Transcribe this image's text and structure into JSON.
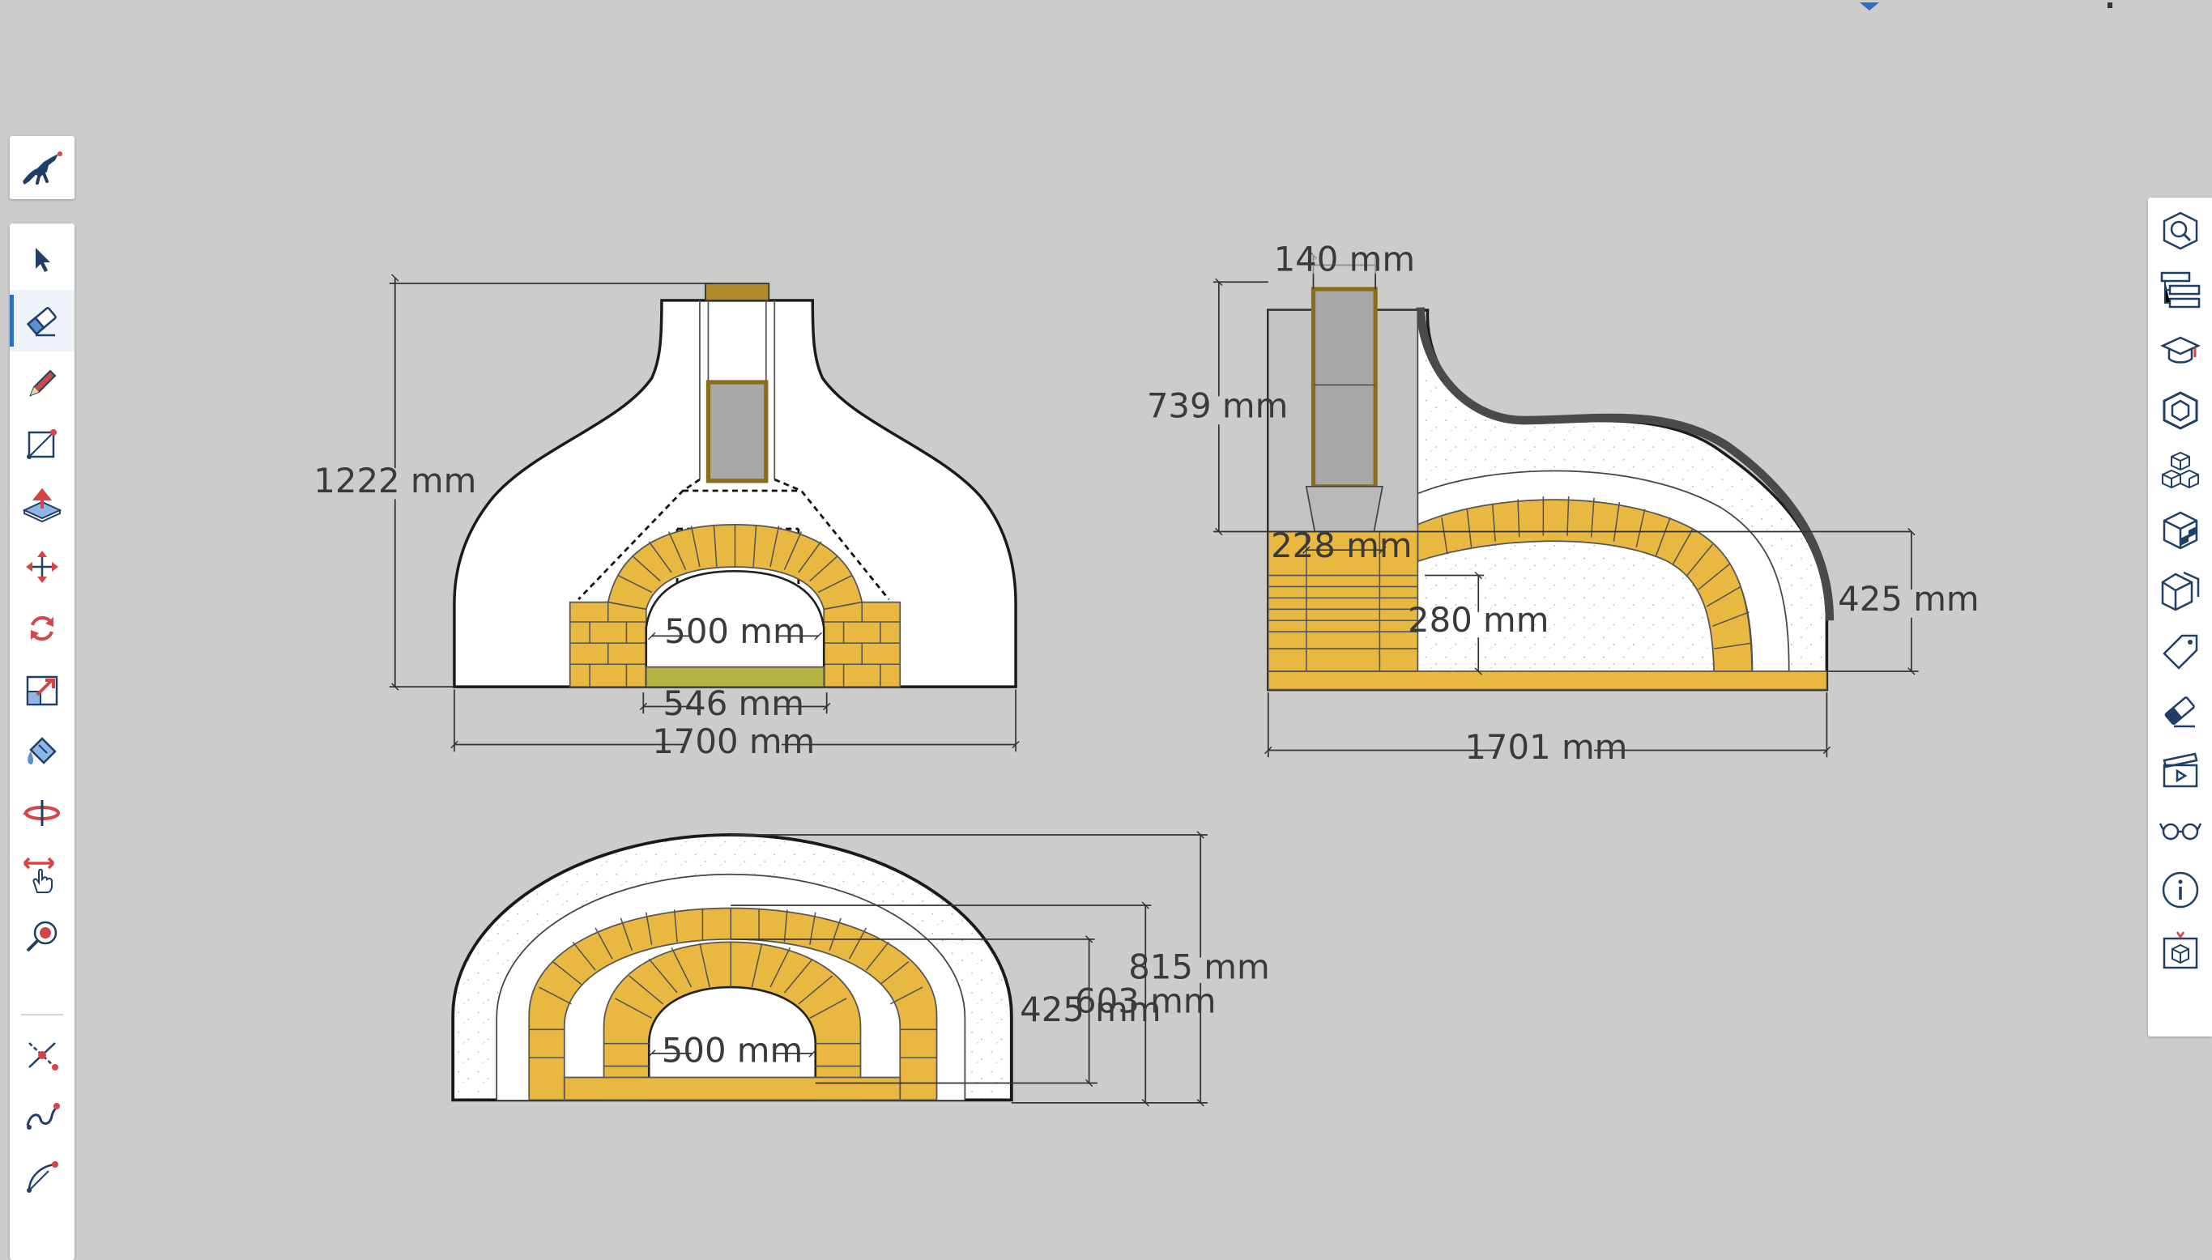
{
  "app": {
    "accent_color": "#2f6fc0",
    "brick_color": "#e9b840",
    "canvas_color": "#cccccb"
  },
  "logo": {
    "icon": "sketchup-logo-icon"
  },
  "left_toolbar": {
    "tools": [
      {
        "name": "select-tool",
        "icon": "arrow-cursor-icon",
        "active": false
      },
      {
        "name": "eraser-tool",
        "icon": "eraser-icon",
        "active": true
      },
      {
        "name": "line-tool",
        "icon": "pencil-icon",
        "active": false
      },
      {
        "name": "rectangle-tool",
        "icon": "rectangle-icon",
        "active": false
      },
      {
        "name": "push-pull-tool",
        "icon": "push-pull-icon",
        "active": false
      },
      {
        "name": "move-tool",
        "icon": "move-arrows-icon",
        "active": false
      },
      {
        "name": "rotate-tool",
        "icon": "rotate-icon",
        "active": false
      },
      {
        "name": "scale-tool",
        "icon": "scale-icon",
        "active": false
      },
      {
        "name": "paint-bucket-tool",
        "icon": "paint-bucket-icon",
        "active": false
      },
      {
        "name": "orbit-tool",
        "icon": "orbit-icon",
        "active": false
      },
      {
        "name": "pan-tool",
        "icon": "pan-hand-icon",
        "active": false
      },
      {
        "name": "zoom-tool",
        "icon": "zoom-icon",
        "active": false
      },
      {
        "name": "tape-measure-tool",
        "icon": "tape-measure-icon",
        "active": false
      },
      {
        "name": "freehand-tool",
        "icon": "freehand-icon",
        "active": false
      },
      {
        "name": "arc-tool",
        "icon": "arc-icon",
        "active": false
      }
    ]
  },
  "right_panel": {
    "tools": [
      {
        "name": "search-panel",
        "icon": "search-cube-icon"
      },
      {
        "name": "outliner-panel",
        "icon": "outliner-icon"
      },
      {
        "name": "instructor-panel",
        "icon": "graduation-cap-icon"
      },
      {
        "name": "entity-info-panel",
        "icon": "hexagon-icon"
      },
      {
        "name": "components-panel",
        "icon": "cubes-icon"
      },
      {
        "name": "materials-panel",
        "icon": "checker-cube-icon"
      },
      {
        "name": "styles-panel",
        "icon": "styles-cube-icon"
      },
      {
        "name": "tags-panel",
        "icon": "tag-icon"
      },
      {
        "name": "soften-panel",
        "icon": "eraser-panel-icon"
      },
      {
        "name": "scenes-panel",
        "icon": "clapperboard-icon"
      },
      {
        "name": "display-panel",
        "icon": "glasses-icon"
      },
      {
        "name": "info-panel",
        "icon": "info-icon"
      },
      {
        "name": "extension-panel",
        "icon": "package-icon"
      }
    ]
  },
  "drawing": {
    "front_view": {
      "height_label": "1222 mm",
      "opening_label": "500 mm",
      "hearth_label": "546 mm",
      "width_label": "1700 mm"
    },
    "side_view": {
      "chimney_label": "140 mm",
      "chimney_height_label": "739 mm",
      "flue_label": "228 mm",
      "door_height_label": "280 mm",
      "dome_height_label": "425 mm",
      "width_label": "1701 mm"
    },
    "section_view": {
      "opening_label": "500 mm",
      "inner_height_label": "425 mm",
      "mid_height_label": "603 mm",
      "outer_height_label": "815 mm"
    }
  }
}
